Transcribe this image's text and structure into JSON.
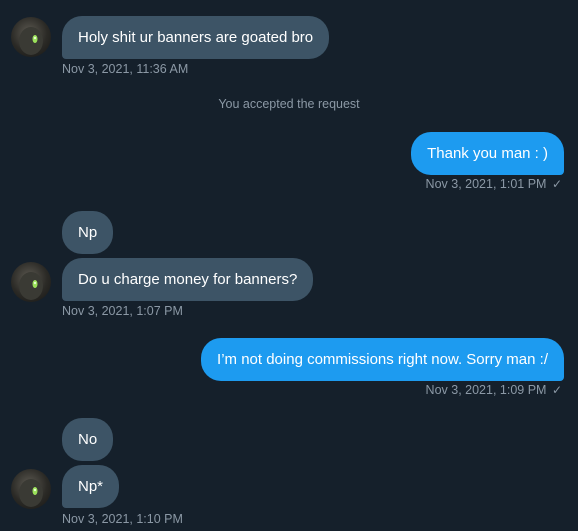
{
  "conversation": {
    "messages": [
      {
        "text": "Holy shit ur banners are goated bro",
        "time": "Nov 3, 2021, 11:36 AM"
      },
      {
        "text": "Thank you man : )",
        "time": "Nov 3, 2021, 1:01 PM"
      },
      {
        "text": "Np"
      },
      {
        "text": "Do u charge money for banners?",
        "time": "Nov 3, 2021, 1:07 PM"
      },
      {
        "text": "I’m not doing commissions right now. Sorry man :/",
        "time": "Nov 3, 2021, 1:09 PM"
      },
      {
        "text": "No"
      },
      {
        "text": "Np*",
        "time": "Nov 3, 2021, 1:10 PM"
      }
    ],
    "system_notice": "You accepted the request",
    "read_check": "✓"
  },
  "icons": {
    "avatar": "avatar-image",
    "sent_check": "check-icon"
  },
  "colors": {
    "background": "#15202b",
    "incoming_bubble": "#3d5466",
    "outgoing_bubble": "#1d9bf0",
    "meta_text": "#8b98a5"
  }
}
